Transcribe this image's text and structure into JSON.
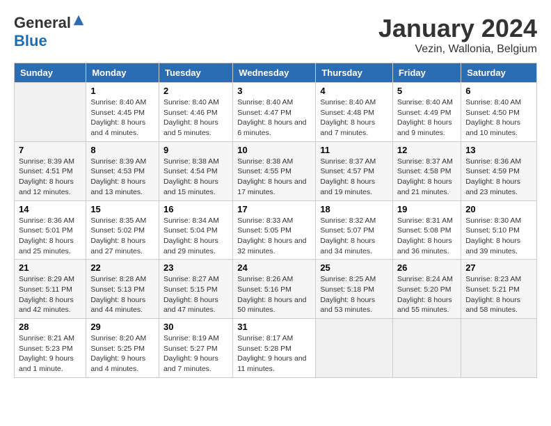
{
  "logo": {
    "general": "General",
    "blue": "Blue"
  },
  "title": "January 2024",
  "subtitle": "Vezin, Wallonia, Belgium",
  "days_of_week": [
    "Sunday",
    "Monday",
    "Tuesday",
    "Wednesday",
    "Thursday",
    "Friday",
    "Saturday"
  ],
  "weeks": [
    [
      {
        "day": "",
        "empty": true
      },
      {
        "day": "1",
        "sunrise": "Sunrise: 8:40 AM",
        "sunset": "Sunset: 4:45 PM",
        "daylight": "Daylight: 8 hours and 4 minutes."
      },
      {
        "day": "2",
        "sunrise": "Sunrise: 8:40 AM",
        "sunset": "Sunset: 4:46 PM",
        "daylight": "Daylight: 8 hours and 5 minutes."
      },
      {
        "day": "3",
        "sunrise": "Sunrise: 8:40 AM",
        "sunset": "Sunset: 4:47 PM",
        "daylight": "Daylight: 8 hours and 6 minutes."
      },
      {
        "day": "4",
        "sunrise": "Sunrise: 8:40 AM",
        "sunset": "Sunset: 4:48 PM",
        "daylight": "Daylight: 8 hours and 7 minutes."
      },
      {
        "day": "5",
        "sunrise": "Sunrise: 8:40 AM",
        "sunset": "Sunset: 4:49 PM",
        "daylight": "Daylight: 8 hours and 9 minutes."
      },
      {
        "day": "6",
        "sunrise": "Sunrise: 8:40 AM",
        "sunset": "Sunset: 4:50 PM",
        "daylight": "Daylight: 8 hours and 10 minutes."
      }
    ],
    [
      {
        "day": "7",
        "sunrise": "Sunrise: 8:39 AM",
        "sunset": "Sunset: 4:51 PM",
        "daylight": "Daylight: 8 hours and 12 minutes."
      },
      {
        "day": "8",
        "sunrise": "Sunrise: 8:39 AM",
        "sunset": "Sunset: 4:53 PM",
        "daylight": "Daylight: 8 hours and 13 minutes."
      },
      {
        "day": "9",
        "sunrise": "Sunrise: 8:38 AM",
        "sunset": "Sunset: 4:54 PM",
        "daylight": "Daylight: 8 hours and 15 minutes."
      },
      {
        "day": "10",
        "sunrise": "Sunrise: 8:38 AM",
        "sunset": "Sunset: 4:55 PM",
        "daylight": "Daylight: 8 hours and 17 minutes."
      },
      {
        "day": "11",
        "sunrise": "Sunrise: 8:37 AM",
        "sunset": "Sunset: 4:57 PM",
        "daylight": "Daylight: 8 hours and 19 minutes."
      },
      {
        "day": "12",
        "sunrise": "Sunrise: 8:37 AM",
        "sunset": "Sunset: 4:58 PM",
        "daylight": "Daylight: 8 hours and 21 minutes."
      },
      {
        "day": "13",
        "sunrise": "Sunrise: 8:36 AM",
        "sunset": "Sunset: 4:59 PM",
        "daylight": "Daylight: 8 hours and 23 minutes."
      }
    ],
    [
      {
        "day": "14",
        "sunrise": "Sunrise: 8:36 AM",
        "sunset": "Sunset: 5:01 PM",
        "daylight": "Daylight: 8 hours and 25 minutes."
      },
      {
        "day": "15",
        "sunrise": "Sunrise: 8:35 AM",
        "sunset": "Sunset: 5:02 PM",
        "daylight": "Daylight: 8 hours and 27 minutes."
      },
      {
        "day": "16",
        "sunrise": "Sunrise: 8:34 AM",
        "sunset": "Sunset: 5:04 PM",
        "daylight": "Daylight: 8 hours and 29 minutes."
      },
      {
        "day": "17",
        "sunrise": "Sunrise: 8:33 AM",
        "sunset": "Sunset: 5:05 PM",
        "daylight": "Daylight: 8 hours and 32 minutes."
      },
      {
        "day": "18",
        "sunrise": "Sunrise: 8:32 AM",
        "sunset": "Sunset: 5:07 PM",
        "daylight": "Daylight: 8 hours and 34 minutes."
      },
      {
        "day": "19",
        "sunrise": "Sunrise: 8:31 AM",
        "sunset": "Sunset: 5:08 PM",
        "daylight": "Daylight: 8 hours and 36 minutes."
      },
      {
        "day": "20",
        "sunrise": "Sunrise: 8:30 AM",
        "sunset": "Sunset: 5:10 PM",
        "daylight": "Daylight: 8 hours and 39 minutes."
      }
    ],
    [
      {
        "day": "21",
        "sunrise": "Sunrise: 8:29 AM",
        "sunset": "Sunset: 5:11 PM",
        "daylight": "Daylight: 8 hours and 42 minutes."
      },
      {
        "day": "22",
        "sunrise": "Sunrise: 8:28 AM",
        "sunset": "Sunset: 5:13 PM",
        "daylight": "Daylight: 8 hours and 44 minutes."
      },
      {
        "day": "23",
        "sunrise": "Sunrise: 8:27 AM",
        "sunset": "Sunset: 5:15 PM",
        "daylight": "Daylight: 8 hours and 47 minutes."
      },
      {
        "day": "24",
        "sunrise": "Sunrise: 8:26 AM",
        "sunset": "Sunset: 5:16 PM",
        "daylight": "Daylight: 8 hours and 50 minutes."
      },
      {
        "day": "25",
        "sunrise": "Sunrise: 8:25 AM",
        "sunset": "Sunset: 5:18 PM",
        "daylight": "Daylight: 8 hours and 53 minutes."
      },
      {
        "day": "26",
        "sunrise": "Sunrise: 8:24 AM",
        "sunset": "Sunset: 5:20 PM",
        "daylight": "Daylight: 8 hours and 55 minutes."
      },
      {
        "day": "27",
        "sunrise": "Sunrise: 8:23 AM",
        "sunset": "Sunset: 5:21 PM",
        "daylight": "Daylight: 8 hours and 58 minutes."
      }
    ],
    [
      {
        "day": "28",
        "sunrise": "Sunrise: 8:21 AM",
        "sunset": "Sunset: 5:23 PM",
        "daylight": "Daylight: 9 hours and 1 minute."
      },
      {
        "day": "29",
        "sunrise": "Sunrise: 8:20 AM",
        "sunset": "Sunset: 5:25 PM",
        "daylight": "Daylight: 9 hours and 4 minutes."
      },
      {
        "day": "30",
        "sunrise": "Sunrise: 8:19 AM",
        "sunset": "Sunset: 5:27 PM",
        "daylight": "Daylight: 9 hours and 7 minutes."
      },
      {
        "day": "31",
        "sunrise": "Sunrise: 8:17 AM",
        "sunset": "Sunset: 5:28 PM",
        "daylight": "Daylight: 9 hours and 11 minutes."
      },
      {
        "day": "",
        "empty": true
      },
      {
        "day": "",
        "empty": true
      },
      {
        "day": "",
        "empty": true
      }
    ]
  ]
}
